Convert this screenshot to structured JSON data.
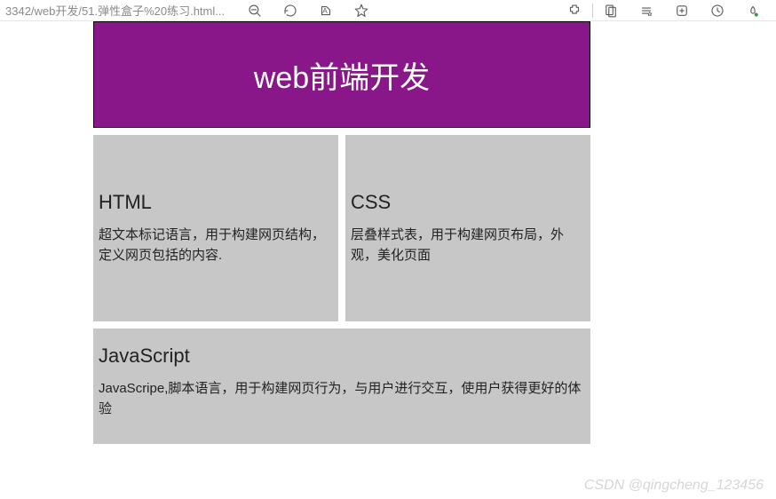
{
  "toolbar": {
    "url": "3342/web开发/51.弹性盒子%20练习.html..."
  },
  "hero": {
    "title": "web前端开发"
  },
  "cards": [
    {
      "title": "HTML",
      "desc": "超文本标记语言，用于构建网页结构，定义网页包括的内容."
    },
    {
      "title": "CSS",
      "desc": "层叠样式表，用于构建网页布局，外观，美化页面"
    },
    {
      "title": "JavaScript",
      "desc": "JavaScripe,脚本语言，用于构建网页行为，与用户进行交互，使用户获得更好的体验"
    }
  ],
  "watermark": "CSDN @qingcheng_123456"
}
